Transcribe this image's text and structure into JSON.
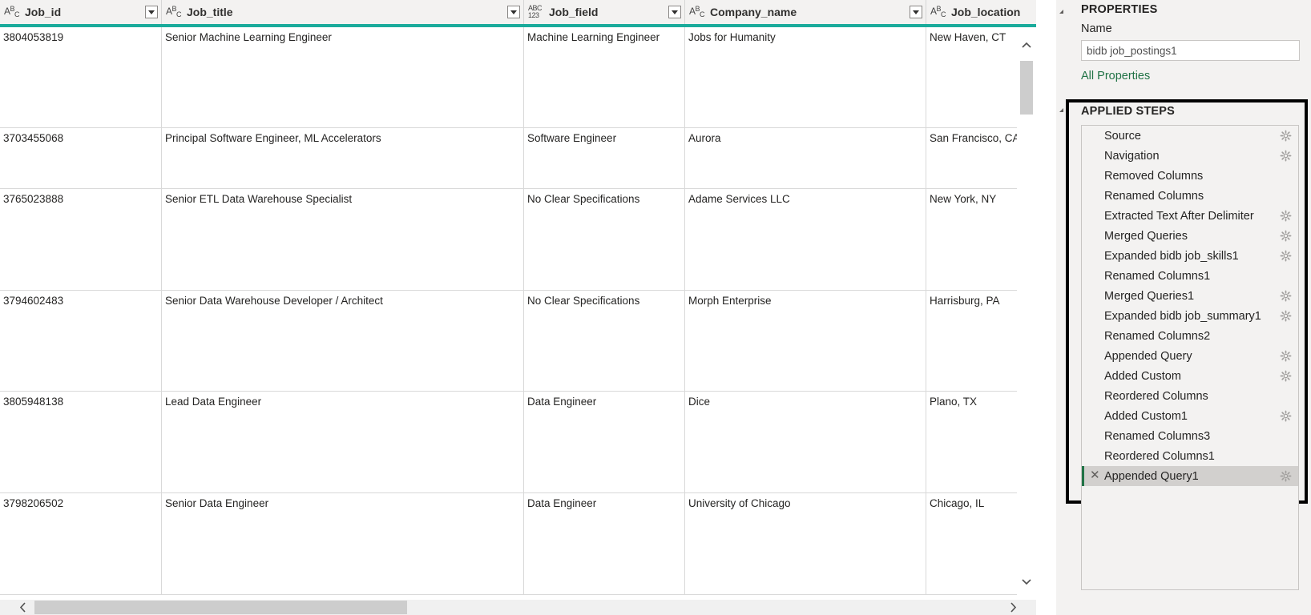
{
  "grid": {
    "columns": [
      {
        "name": "Job_id",
        "type": "abc"
      },
      {
        "name": "Job_title",
        "type": "abc"
      },
      {
        "name": "Job_field",
        "type": "abc123"
      },
      {
        "name": "Company_name",
        "type": "abc"
      },
      {
        "name": "Job_location",
        "type": "abc"
      }
    ],
    "rows": [
      [
        "3804053819",
        "Senior Machine Learning Engineer",
        "Machine Learning Engineer",
        "Jobs for Humanity",
        "New Haven, CT"
      ],
      [
        "3703455068",
        "Principal Software Engineer, ML Accelerators",
        "Software Engineer",
        "Aurora",
        "San Francisco, CA"
      ],
      [
        "3765023888",
        "Senior ETL Data Warehouse Specialist",
        "No Clear Specifications",
        "Adame Services LLC",
        "New York, NY"
      ],
      [
        "3794602483",
        "Senior Data Warehouse Developer / Architect",
        "No Clear Specifications",
        "Morph Enterprise",
        "Harrisburg, PA"
      ],
      [
        "3805948138",
        "Lead Data Engineer",
        "Data Engineer",
        "Dice",
        "Plano, TX"
      ],
      [
        "3798206502",
        "Senior Data Engineer",
        "Data Engineer",
        "University of Chicago",
        "Chicago, IL"
      ]
    ],
    "type_icon_abc": "ABC",
    "type_icon_abc123": "ABC 123"
  },
  "properties": {
    "title": "PROPERTIES",
    "name_label": "Name",
    "name_value": "bidb job_postings1",
    "all_properties_link": "All Properties"
  },
  "applied_steps": {
    "title": "APPLIED STEPS",
    "steps": [
      {
        "label": "Source",
        "gear": true
      },
      {
        "label": "Navigation",
        "gear": true
      },
      {
        "label": "Removed Columns",
        "gear": false
      },
      {
        "label": "Renamed Columns",
        "gear": false
      },
      {
        "label": "Extracted Text After Delimiter",
        "gear": true
      },
      {
        "label": "Merged Queries",
        "gear": true
      },
      {
        "label": "Expanded bidb job_skills1",
        "gear": true
      },
      {
        "label": "Renamed Columns1",
        "gear": false
      },
      {
        "label": "Merged Queries1",
        "gear": true
      },
      {
        "label": "Expanded bidb job_summary1",
        "gear": true
      },
      {
        "label": "Renamed Columns2",
        "gear": false
      },
      {
        "label": "Appended Query",
        "gear": true
      },
      {
        "label": "Added Custom",
        "gear": true
      },
      {
        "label": "Reordered Columns",
        "gear": false
      },
      {
        "label": "Added Custom1",
        "gear": true
      },
      {
        "label": "Renamed Columns3",
        "gear": false
      },
      {
        "label": "Reordered Columns1",
        "gear": false
      },
      {
        "label": "Appended Query1",
        "gear": true,
        "selected": true
      }
    ]
  },
  "colors": {
    "accent_teal": "#1aab9b",
    "link_green": "#217346",
    "highlight_frame": "#000000"
  },
  "icons": {
    "gear": "gear-icon",
    "delete_step": "delete-step-icon",
    "scroll_up": "chevron-up-icon",
    "scroll_down": "chevron-down-icon",
    "scroll_left": "chevron-left-icon",
    "scroll_right": "chevron-right-icon",
    "filter": "filter-dropdown-icon"
  }
}
